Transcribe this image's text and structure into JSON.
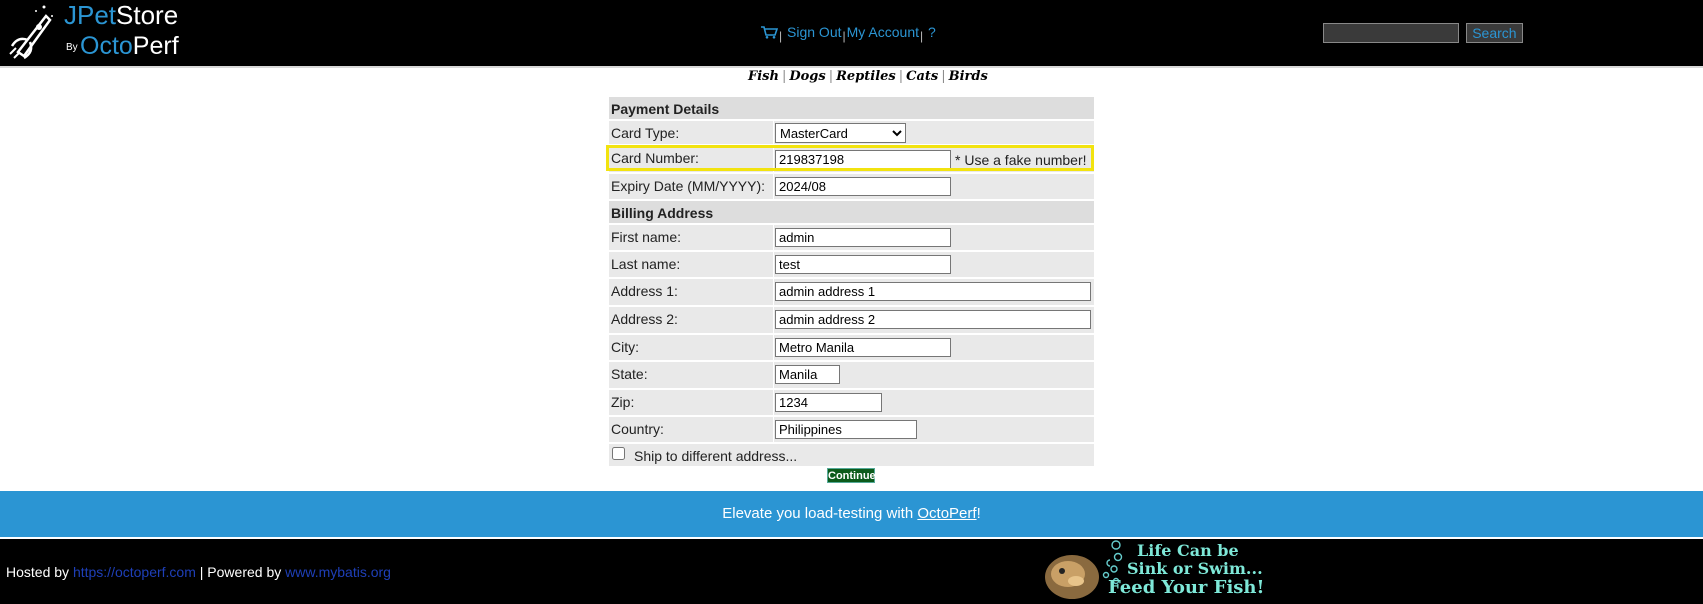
{
  "header": {
    "logo_jpet_blue": "JPet",
    "logo_jpet_white": "Store",
    "logo_by": "By",
    "logo_octo": "Octo",
    "logo_perf": "Perf",
    "menu": {
      "cart_icon": "cart-icon",
      "sign_out": "Sign Out",
      "my_account": "My Account",
      "help": "?"
    },
    "search": {
      "value": "",
      "button_label": "Search"
    }
  },
  "quicklinks": [
    "Fish",
    "Dogs",
    "Reptiles",
    "Cats",
    "Birds"
  ],
  "form": {
    "payment_heading": "Payment Details",
    "card_type": {
      "label": "Card Type:",
      "value": "MasterCard"
    },
    "card_number": {
      "label": "Card Number:",
      "value": "219837198",
      "note": "* Use a fake number!"
    },
    "expiry": {
      "label": "Expiry Date (MM/YYYY):",
      "value": "2024/08"
    },
    "billing_heading": "Billing Address",
    "first_name": {
      "label": "First name:",
      "value": "admin"
    },
    "last_name": {
      "label": "Last name:",
      "value": "test"
    },
    "address1": {
      "label": "Address 1:",
      "value": "admin address 1"
    },
    "address2": {
      "label": "Address 2:",
      "value": "admin address 2"
    },
    "city": {
      "label": "City:",
      "value": "Metro Manila"
    },
    "state": {
      "label": "State:",
      "value": "Manila"
    },
    "zip": {
      "label": "Zip:",
      "value": "1234"
    },
    "country": {
      "label": "Country:",
      "value": "Philippines"
    },
    "ship_different": {
      "label": "Ship to different address...",
      "checked": false
    },
    "continue_label": "Continue"
  },
  "banner": {
    "text_before": "Elevate you load-testing with ",
    "link": "OctoPerf",
    "text_after": "!"
  },
  "footer": {
    "hosted_by": "Hosted by ",
    "hosted_link": "https://octoperf.com",
    "powered_by": " | Powered by ",
    "powered_link": "www.mybatis.org",
    "fish_banner_line1": "Life Can be",
    "fish_banner_line2": "Sink or Swim...",
    "fish_banner_line3": "Feed Your Fish!"
  },
  "colors": {
    "header_bg": "#000000",
    "link_blue": "#2b95d3",
    "banner_bg": "#2b95d3",
    "highlight": "#f2e30f",
    "continue_bg": "#0c5b1b"
  }
}
